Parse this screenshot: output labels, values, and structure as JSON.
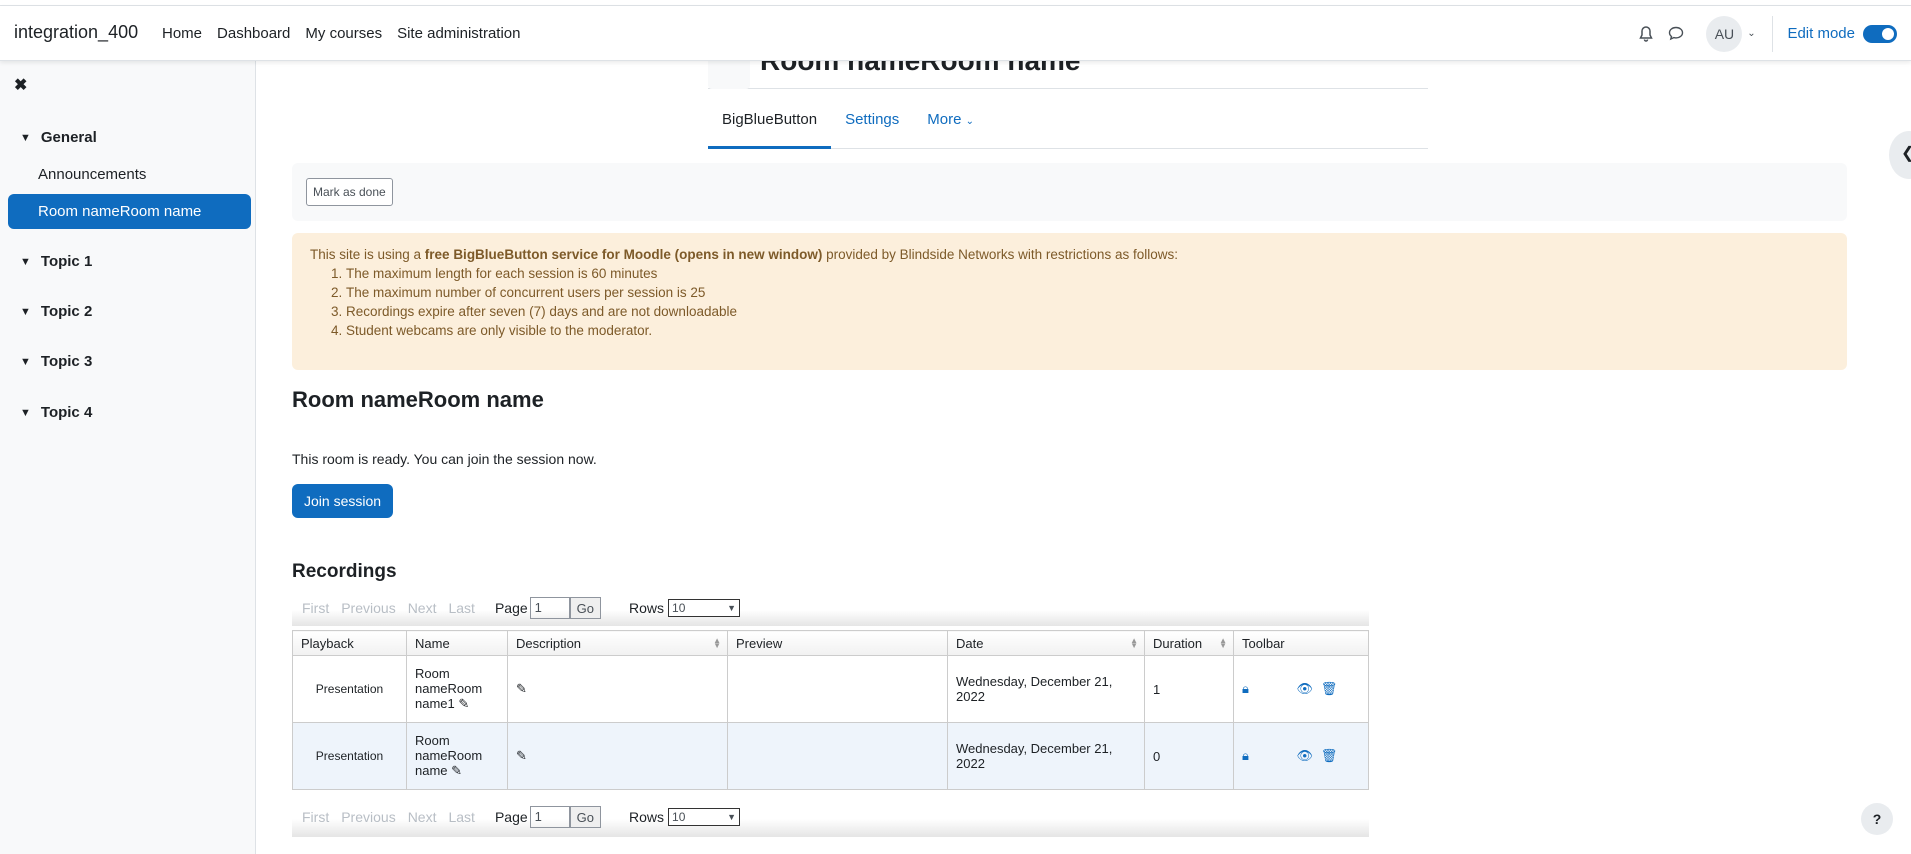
{
  "navbar": {
    "brand": "integration_400",
    "links": [
      "Home",
      "Dashboard",
      "My courses",
      "Site administration"
    ],
    "avatar": "AU",
    "edit_mode": "Edit mode"
  },
  "drawer": {
    "close": "✖",
    "sections": [
      {
        "label": "General"
      },
      {
        "label": "Topic 1"
      },
      {
        "label": "Topic 2"
      },
      {
        "label": "Topic 3"
      },
      {
        "label": "Topic 4"
      }
    ],
    "items": [
      "Announcements",
      "Room nameRoom name"
    ]
  },
  "header": {
    "title": "Room nameRoom name"
  },
  "tabs": [
    "BigBlueButton",
    "Settings",
    "More"
  ],
  "completion": {
    "button": "Mark as done"
  },
  "alert": {
    "pre": "This site is using a ",
    "bold": "free BigBlueButton service for Moodle (opens in new window)",
    "post": " provided by Blindside Networks with restrictions as follows:",
    "items": [
      "The maximum length for each session is 60 minutes",
      "The maximum number of concurrent users per session is 25",
      "Recordings expire after seven (7) days and are not downloadable",
      "Student webcams are only visible to the moderator."
    ]
  },
  "room": {
    "title": "Room nameRoom name",
    "status": "This room is ready. You can join the session now.",
    "join": "Join session"
  },
  "recordings": {
    "title": "Recordings",
    "pager": {
      "first": "First",
      "previous": "Previous",
      "next": "Next",
      "last": "Last",
      "page_label": "Page",
      "page_value": "1",
      "go": "Go",
      "rows_label": "Rows",
      "rows_value": "10"
    },
    "columns": [
      "Playback",
      "Name",
      "Description",
      "Preview",
      "Date",
      "Duration",
      "Toolbar"
    ],
    "rows": [
      {
        "playback": "Presentation",
        "name": "Room nameRoom name1",
        "date": "Wednesday, December 21, 2022",
        "duration": "1"
      },
      {
        "playback": "Presentation",
        "name": "Room nameRoom name",
        "date": "Wednesday, December 21, 2022",
        "duration": "0"
      }
    ]
  },
  "help": "?"
}
